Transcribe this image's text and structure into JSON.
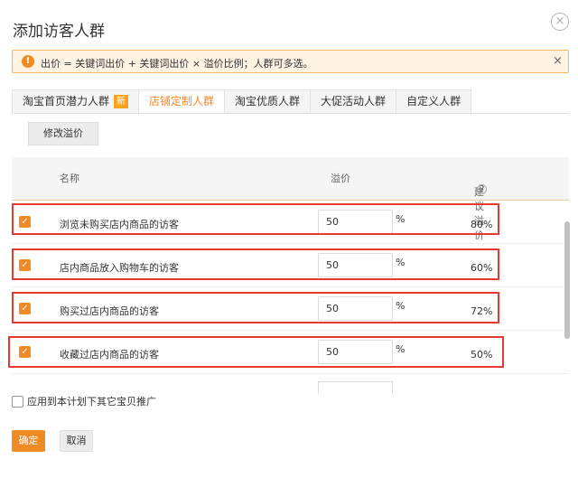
{
  "dialog": {
    "title": "添加访客人群",
    "close_symbol": "×"
  },
  "notice": {
    "icon": "!",
    "text": "出价 = 关键词出价 + 关键词出价 × 溢价比例；人群可多选。",
    "close_symbol": "×"
  },
  "tabs": [
    {
      "label": "淘宝首页潜力人群",
      "badge": "新"
    },
    {
      "label": "店铺定制人群",
      "active": true
    },
    {
      "label": "淘宝优质人群"
    },
    {
      "label": "大促活动人群"
    },
    {
      "label": "自定义人群"
    }
  ],
  "toolbar": {
    "edit_premium_label": "修改溢价"
  },
  "table": {
    "headers": {
      "name": "名称",
      "premium": "溢价",
      "suggested": "建议溢价"
    },
    "help_symbol": "?",
    "check_symbol": "✓",
    "rows": [
      {
        "name": "浏览未购买店内商品的访客",
        "premium": "50",
        "unit": "%",
        "suggested": "80%",
        "checked": true
      },
      {
        "name": "店内商品放入购物车的访客",
        "premium": "50",
        "unit": "%",
        "suggested": "60%",
        "checked": true
      },
      {
        "name": "购买过店内商品的访客",
        "premium": "50",
        "unit": "%",
        "suggested": "72%",
        "checked": true
      },
      {
        "name": "收藏过店内商品的访客",
        "premium": "50",
        "unit": "%",
        "suggested": "50%",
        "checked": true
      }
    ]
  },
  "apply_all": {
    "label": "应用到本计划下其它宝贝推广",
    "checked": false
  },
  "buttons": {
    "ok": "确定",
    "cancel": "取消"
  },
  "colors": {
    "accent": "#f08a24",
    "highlight": "#e53935",
    "notice_bg": "#fff3e3"
  }
}
